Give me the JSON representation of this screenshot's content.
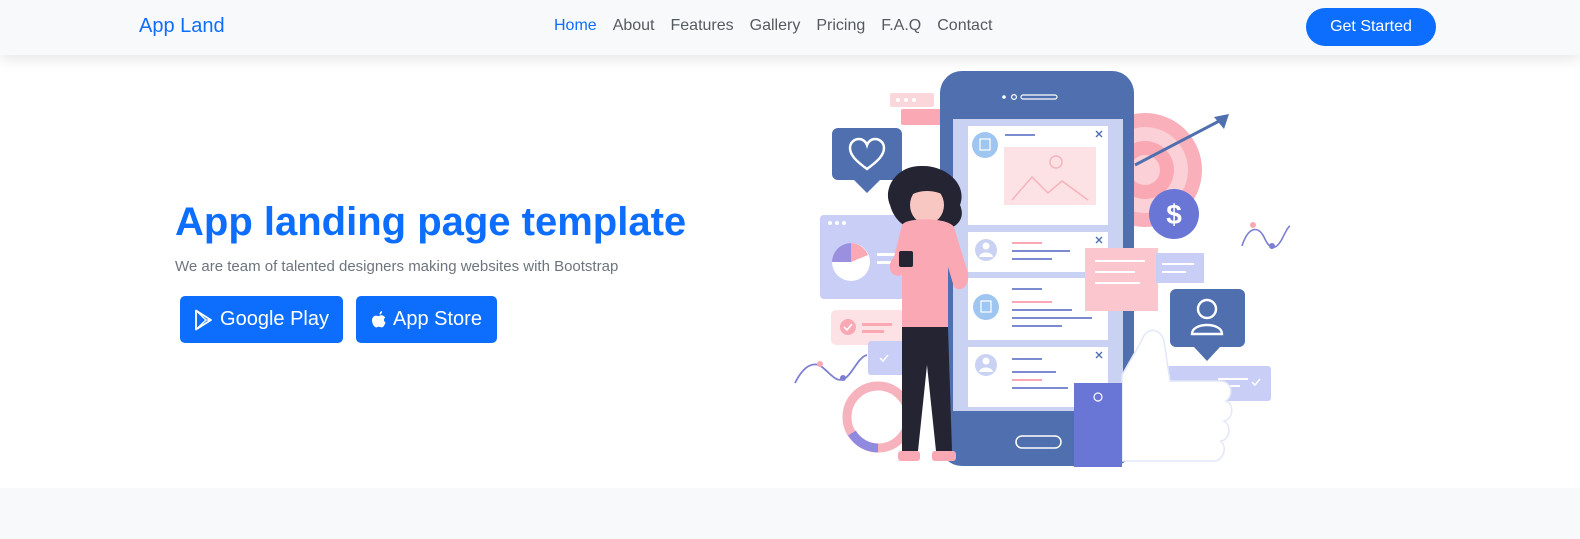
{
  "nav": {
    "brand": "App Land",
    "links": [
      {
        "label": "Home",
        "active": true
      },
      {
        "label": "About"
      },
      {
        "label": "Features"
      },
      {
        "label": "Gallery"
      },
      {
        "label": "Pricing"
      },
      {
        "label": "F.A.Q"
      },
      {
        "label": "Contact"
      }
    ],
    "cta_label": "Get Started"
  },
  "hero": {
    "title": "App landing page template",
    "subtitle": "We are team of talented designers making websites with Bootstrap",
    "google_play_label": "Google Play",
    "app_store_label": "App Store"
  },
  "colors": {
    "primary": "#0d6efd",
    "navbar_bg": "#f8f9fa",
    "text_muted": "#6c757d",
    "phone_blue": "#4f6fae",
    "pink_accent": "#f9a8b4"
  },
  "icons": {
    "google_play": "google-play-icon",
    "app_store": "apple-icon",
    "heart": "heart-icon",
    "dollar": "dollar-icon",
    "user": "user-icon"
  }
}
